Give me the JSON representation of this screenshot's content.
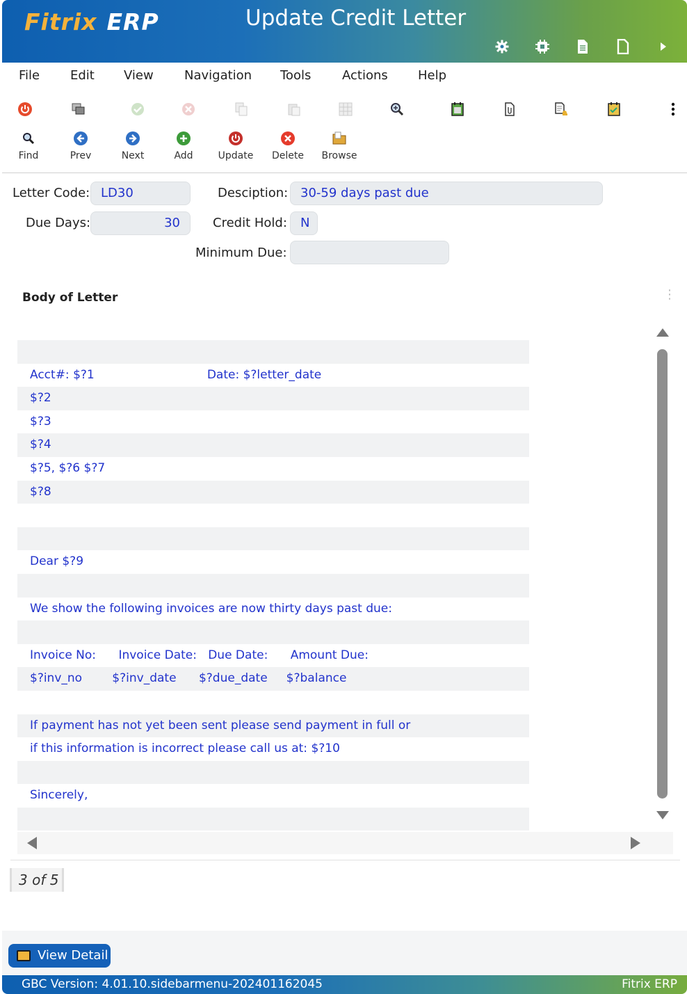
{
  "header": {
    "logo_main": "Fitrix",
    "logo_sub": "ERP",
    "title": "Update Credit Letter",
    "icons": [
      "gear-icon",
      "chip-icon",
      "document-icon",
      "blank-page-icon",
      "play-icon"
    ]
  },
  "menu": [
    "File",
    "Edit",
    "View",
    "Navigation",
    "Tools",
    "Actions",
    "Help"
  ],
  "toolbar_icons": [
    "power-icon",
    "copy-windows-icon",
    "accept-icon",
    "cancel-icon",
    "copy-icon",
    "paste-icon",
    "grid-icon",
    "zoom-icon",
    "calendar-icon",
    "attachment-icon",
    "note-key-icon",
    "calendar-check-icon",
    "more-vertical-icon"
  ],
  "toolbar2": {
    "find": "Find",
    "prev": "Prev",
    "next": "Next",
    "add": "Add",
    "update": "Update",
    "delete": "Delete",
    "browse": "Browse"
  },
  "form": {
    "letter_code_label": "Letter Code:",
    "letter_code": "LD30",
    "description_label": "Desciption:",
    "description": "30-59 days past due",
    "due_days_label": "Due Days:",
    "due_days": "30",
    "credit_hold_label": "Credit Hold:",
    "credit_hold": "N",
    "minimum_due_label": "Minimum Due:",
    "minimum_due": ""
  },
  "letter": {
    "title": "Body of Letter",
    "lines": [
      "",
      "Acct#: $?1                              Date: $?letter_date",
      "$?2",
      "$?3",
      "$?4",
      "$?5, $?6 $?7",
      "$?8",
      "",
      "",
      "Dear $?9",
      "",
      "We show the following invoices are now thirty days past due:",
      "",
      "Invoice No:      Invoice Date:   Due Date:      Amount Due:",
      "$?inv_no        $?inv_date      $?due_date     $?balance",
      "",
      "If payment has not yet been sent please send payment in full or",
      "if this information is incorrect please call us at: $?10",
      "",
      "Sincerely,",
      ""
    ]
  },
  "pager": "3 of 5",
  "view_detail": "View Detail",
  "status": {
    "version": "GBC Version: 4.01.10.sidebarmenu-202401162045",
    "brand": "Fitrix ERP"
  }
}
